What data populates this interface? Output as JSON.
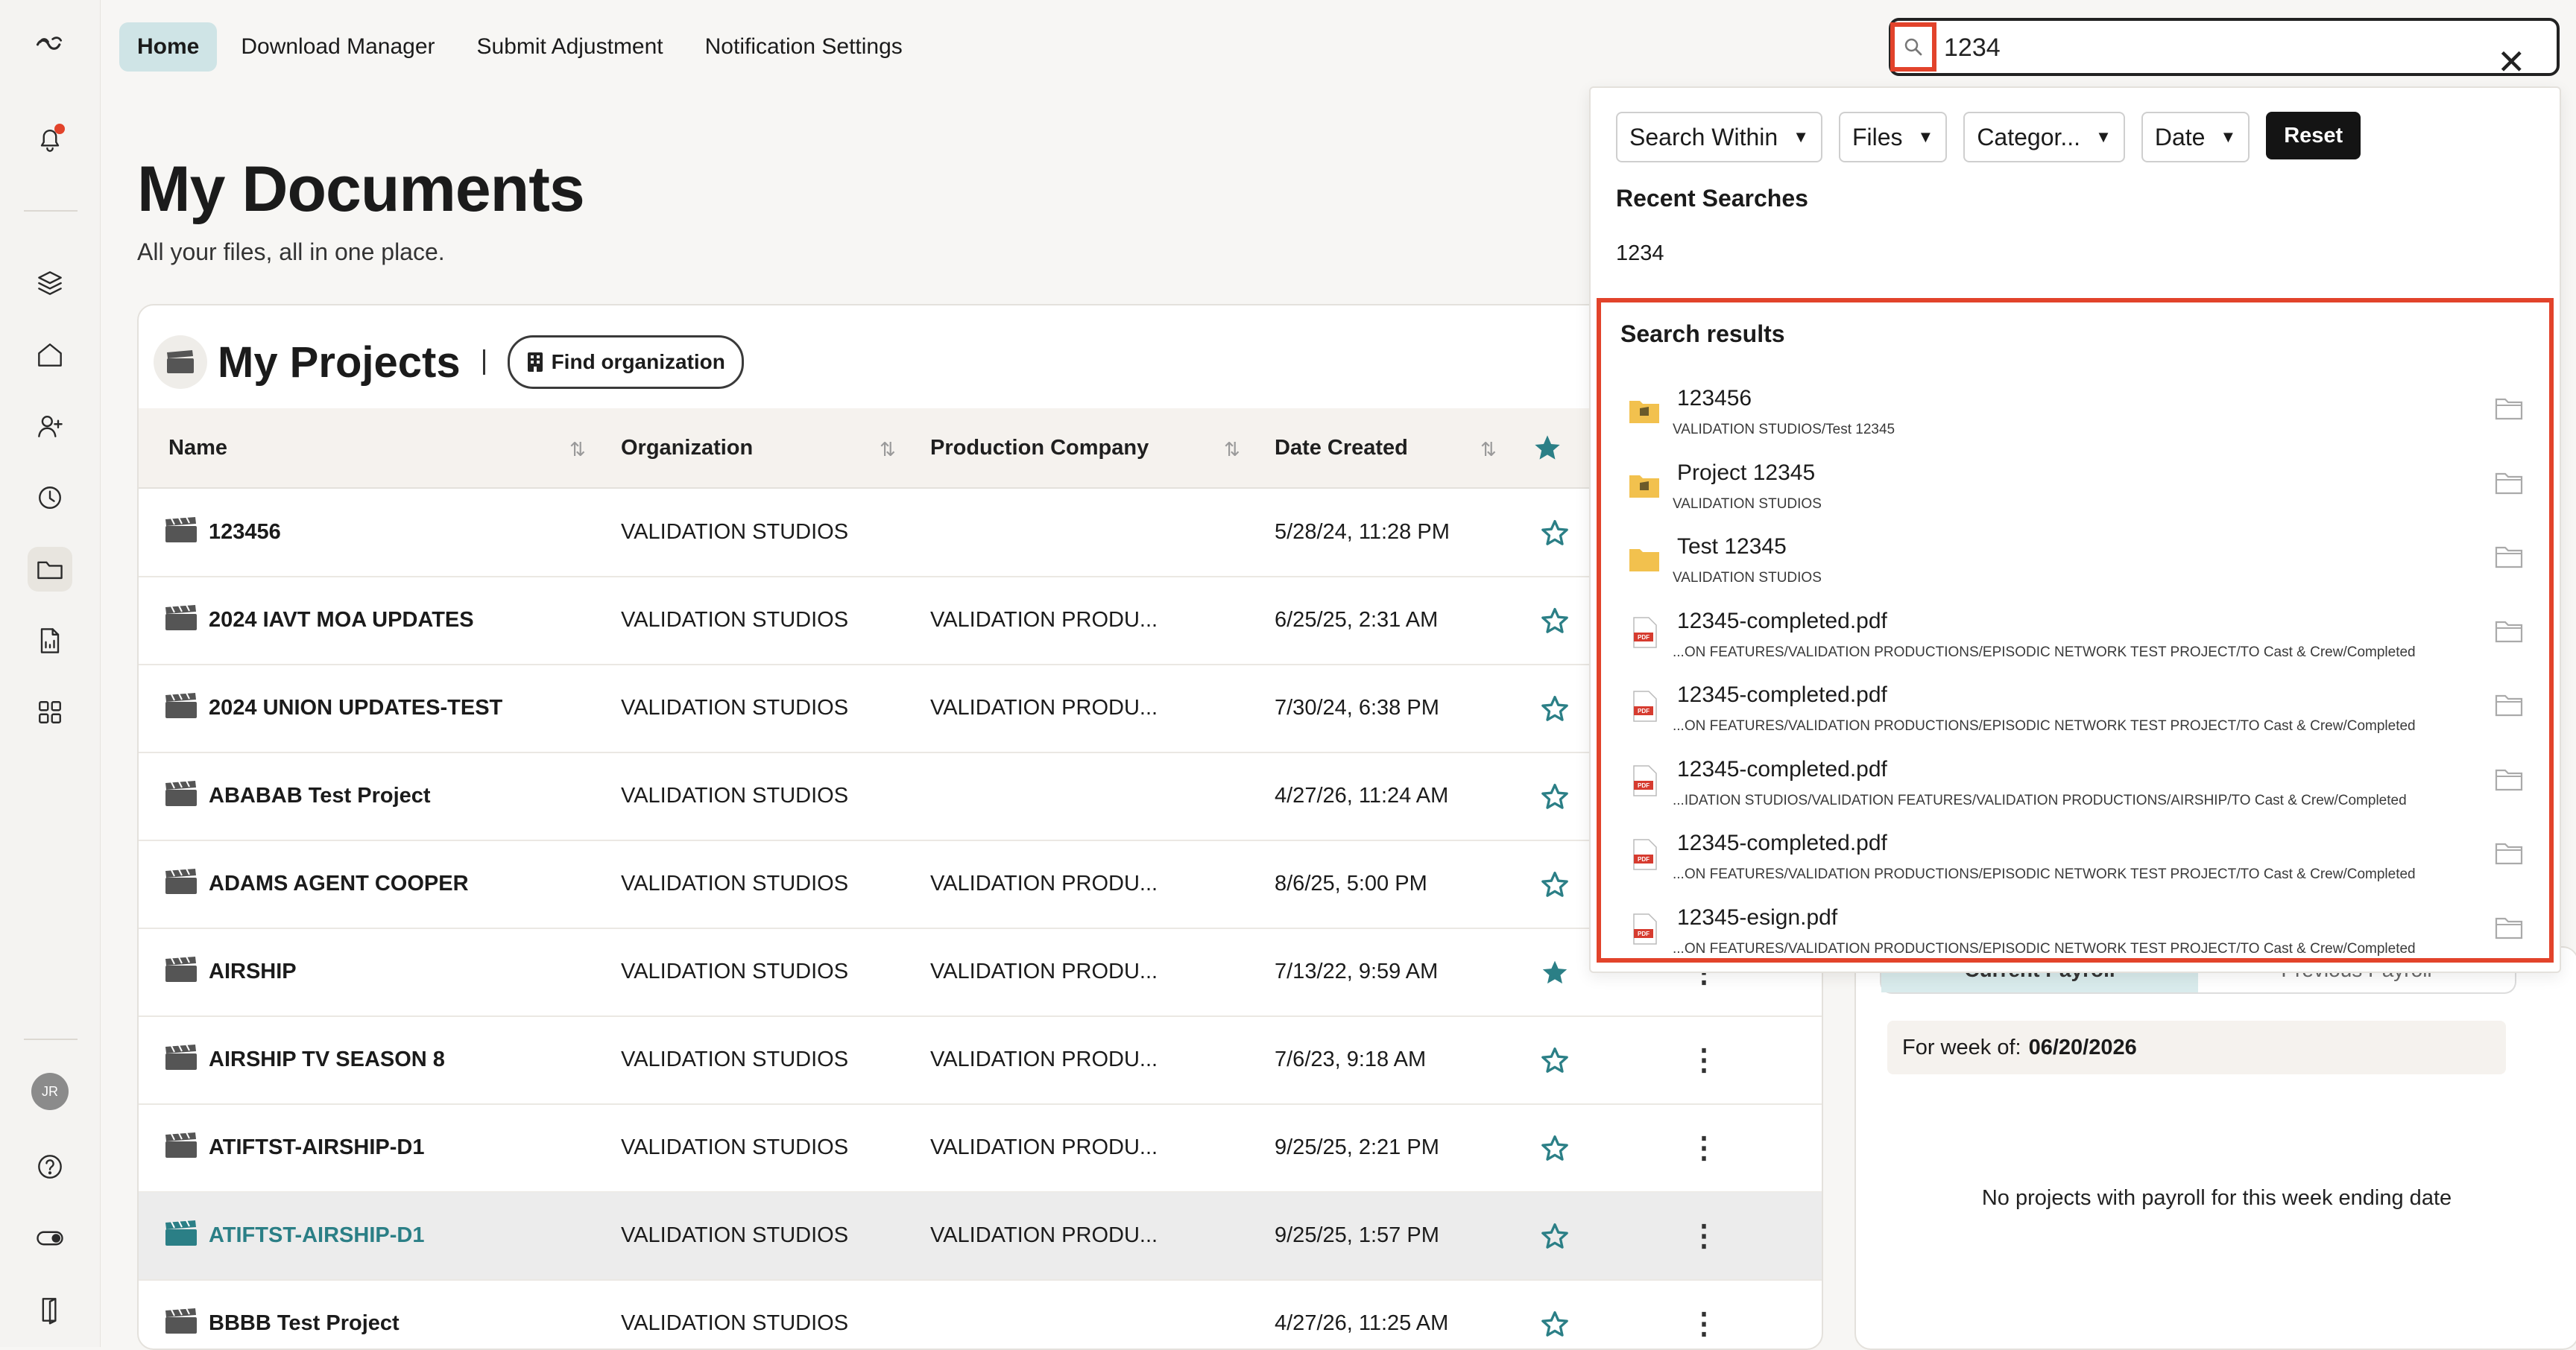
{
  "nav": {
    "tabs": [
      "Home",
      "Download Manager",
      "Submit Adjustment",
      "Notification Settings"
    ],
    "active": "Home"
  },
  "sidebar": {
    "avatar_initials": "JR",
    "icons": [
      "logo-icon",
      "bell-icon",
      "layers-icon",
      "home-icon",
      "add-user-icon",
      "clock-icon",
      "folder-icon",
      "document-icon",
      "apps-icon",
      "help-icon",
      "toggle-icon",
      "exit-icon"
    ]
  },
  "page": {
    "title": "My Documents",
    "subtitle": "All your files, all in one place."
  },
  "projects": {
    "title": "My Projects",
    "find_org_label": "Find organization",
    "columns": [
      "Name",
      "Organization",
      "Production Company",
      "Date Created"
    ],
    "rows": [
      {
        "name": "123456",
        "org": "VALIDATION STUDIOS",
        "company": "",
        "date": "5/28/24, 11:28 PM",
        "starred": false
      },
      {
        "name": "2024 IAVT MOA UPDATES",
        "org": "VALIDATION STUDIOS",
        "company": "VALIDATION PRODU...",
        "date": "6/25/25, 2:31 AM",
        "starred": false
      },
      {
        "name": "2024 UNION UPDATES-TEST",
        "org": "VALIDATION STUDIOS",
        "company": "VALIDATION PRODU...",
        "date": "7/30/24, 6:38 PM",
        "starred": false
      },
      {
        "name": "ABABAB Test Project",
        "org": "VALIDATION STUDIOS",
        "company": "",
        "date": "4/27/26, 11:24 AM",
        "starred": false
      },
      {
        "name": "ADAMS AGENT COOPER",
        "org": "VALIDATION STUDIOS",
        "company": "VALIDATION PRODU...",
        "date": "8/6/25, 5:00 PM",
        "starred": false
      },
      {
        "name": "AIRSHIP",
        "org": "VALIDATION STUDIOS",
        "company": "VALIDATION PRODU...",
        "date": "7/13/22, 9:59 AM",
        "starred": true
      },
      {
        "name": "AIRSHIP TV SEASON 8",
        "org": "VALIDATION STUDIOS",
        "company": "VALIDATION PRODU...",
        "date": "7/6/23, 9:18 AM",
        "starred": false
      },
      {
        "name": "ATIFTST-AIRSHIP-D1",
        "org": "VALIDATION STUDIOS",
        "company": "VALIDATION PRODU...",
        "date": "9/25/25, 2:21 PM",
        "starred": false
      },
      {
        "name": "ATIFTST-AIRSHIP-D1",
        "org": "VALIDATION STUDIOS",
        "company": "VALIDATION PRODU...",
        "date": "9/25/25, 1:57 PM",
        "starred": false,
        "highlight": true
      },
      {
        "name": "BBBB Test Project",
        "org": "VALIDATION STUDIOS",
        "company": "",
        "date": "4/27/26, 11:25 AM",
        "starred": false
      }
    ]
  },
  "payroll": {
    "tabs": [
      "Current Payroll",
      "Previous Payroll"
    ],
    "week_label": "For week of:",
    "week_value": "06/20/2026",
    "empty_text": "No projects with payroll for this week ending date"
  },
  "search": {
    "query": "1234",
    "filters": [
      "Search Within",
      "Files",
      "Categor...",
      "Date"
    ],
    "reset_label": "Reset",
    "recent_heading": "Recent Searches",
    "recent": [
      "1234"
    ],
    "results_heading": "Search results",
    "results": [
      {
        "kind": "project",
        "title": "123456",
        "path": "VALIDATION STUDIOS/Test 12345"
      },
      {
        "kind": "project",
        "title": "Project 12345",
        "path": "VALIDATION STUDIOS"
      },
      {
        "kind": "folder",
        "title": "Test 12345",
        "path": "VALIDATION STUDIOS"
      },
      {
        "kind": "pdf",
        "title": "12345-completed.pdf",
        "path": "...ON FEATURES/VALIDATION PRODUCTIONS/EPISODIC NETWORK TEST PROJECT/TO Cast & Crew/Completed"
      },
      {
        "kind": "pdf",
        "title": "12345-completed.pdf",
        "path": "...ON FEATURES/VALIDATION PRODUCTIONS/EPISODIC NETWORK TEST PROJECT/TO Cast & Crew/Completed"
      },
      {
        "kind": "pdf",
        "title": "12345-completed.pdf",
        "path": "...IDATION STUDIOS/VALIDATION FEATURES/VALIDATION PRODUCTIONS/AIRSHIP/TO Cast & Crew/Completed"
      },
      {
        "kind": "pdf",
        "title": "12345-completed.pdf",
        "path": "...ON FEATURES/VALIDATION PRODUCTIONS/EPISODIC NETWORK TEST PROJECT/TO Cast & Crew/Completed"
      },
      {
        "kind": "pdf",
        "title": "12345-esign.pdf",
        "path": "...ON FEATURES/VALIDATION PRODUCTIONS/EPISODIC NETWORK TEST PROJECT/TO Cast & Crew/Completed"
      }
    ]
  },
  "colors": {
    "accent": "#2b7f86",
    "highlight_border": "#e2432b",
    "active_tab_bg": "#cfe4e6"
  }
}
